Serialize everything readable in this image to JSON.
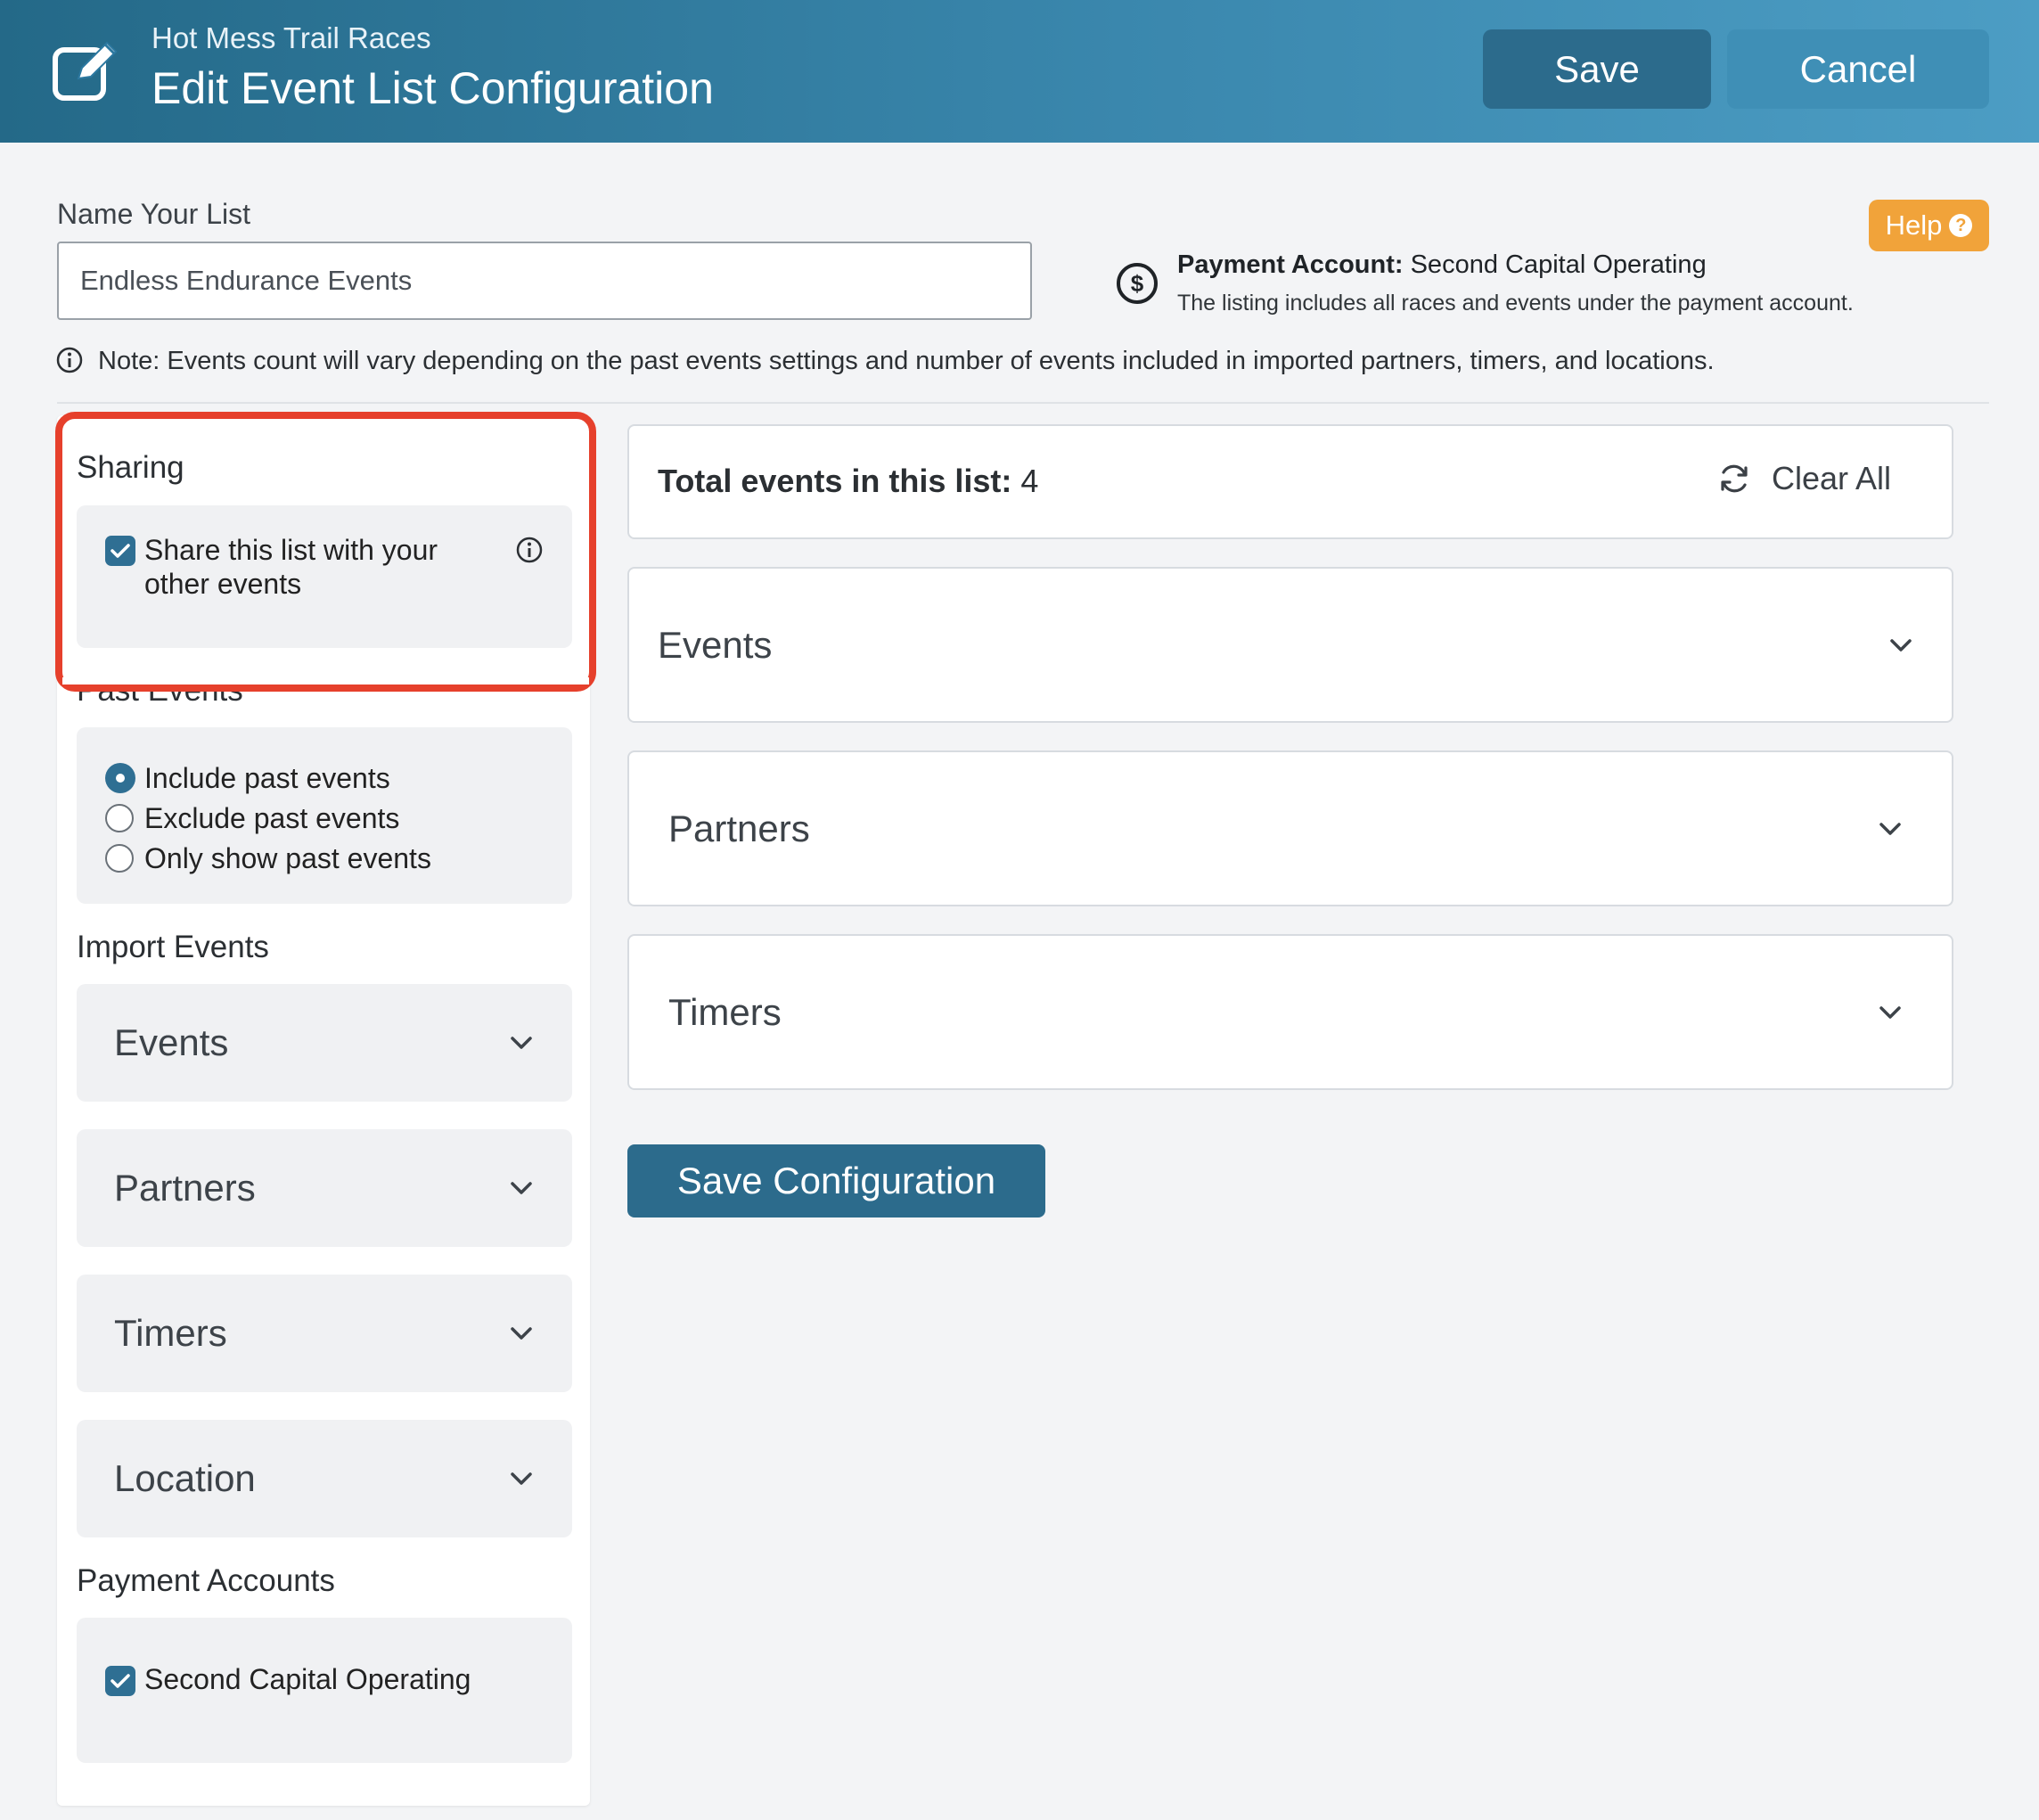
{
  "header": {
    "org_name": "Hot Mess Trail Races",
    "title": "Edit Event List Configuration",
    "save_label": "Save",
    "cancel_label": "Cancel",
    "icon": "edit-icon"
  },
  "name_section": {
    "label": "Name Your List",
    "value": "Endless Endurance Events"
  },
  "help": {
    "label": "Help",
    "icon": "question-circle-icon"
  },
  "payment_account": {
    "prefix": "Payment Account:",
    "name": "Second Capital Operating",
    "description": "The listing includes all races and events under the payment account.",
    "icon": "dollar-circle-icon"
  },
  "note": {
    "text": "Note: Events count will vary depending on the past events settings and number of events included in imported partners, timers, and locations.",
    "icon": "info-circle-icon"
  },
  "sidebar": {
    "sharing": {
      "title": "Sharing",
      "checkbox_line1": "Share this list with your",
      "checkbox_line2": "other events",
      "checked": true
    },
    "past_events": {
      "title": "Past Events",
      "options": [
        {
          "label": "Include past events",
          "selected": true
        },
        {
          "label": "Exclude past events",
          "selected": false
        },
        {
          "label": "Only show past events",
          "selected": false
        }
      ]
    },
    "import_events": {
      "title": "Import Events",
      "dropdowns": [
        "Events",
        "Partners",
        "Timers",
        "Location"
      ]
    },
    "payment_accounts": {
      "title": "Payment Accounts",
      "items": [
        {
          "label": "Second Capital Operating",
          "checked": true
        }
      ]
    }
  },
  "main": {
    "total_label": "Total events in this list:",
    "total_count": "4",
    "clear_all_label": "Clear All",
    "sections": [
      "Events",
      "Partners",
      "Timers"
    ],
    "save_config_label": "Save Configuration"
  },
  "colors": {
    "header_start": "#246988",
    "header_end": "#4c9dc4",
    "primary_button": "#2c6b8c",
    "help_button": "#f1a33a",
    "highlight": "#e6402c",
    "checkbox": "#2f6f93"
  }
}
